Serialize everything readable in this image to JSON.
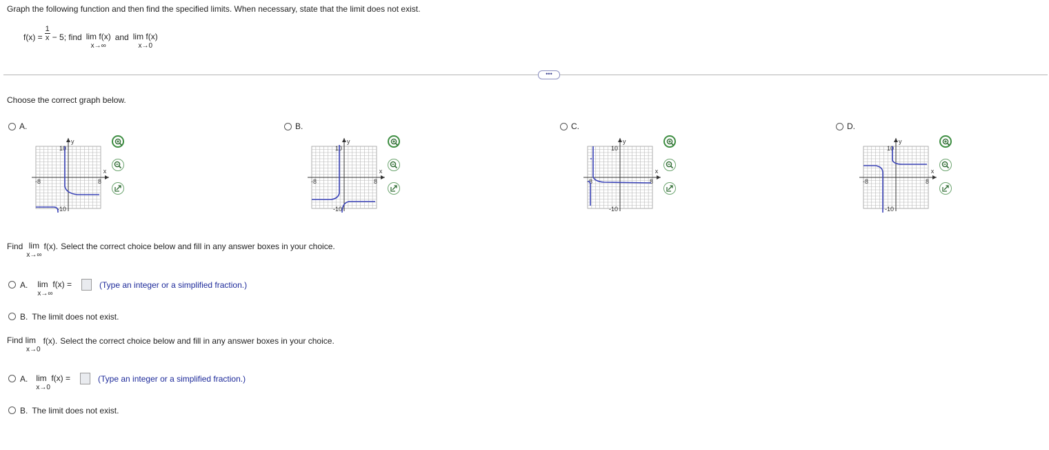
{
  "problem": {
    "instruction": "Graph the following function and then find the specified limits. When necessary, state that the limit does not exist.",
    "fx_prefix": "f(x) =",
    "frac_num": "1",
    "frac_den": "x",
    "fx_suffix": "− 5; find",
    "lim_word": "lim",
    "lim_expr": "f(x)",
    "and_word": "and",
    "sub_inf": "x→∞",
    "sub_zero": "x→0"
  },
  "divider": {
    "dots_label": "•••"
  },
  "graph_question": {
    "prompt": "Choose the correct graph below.",
    "options": [
      {
        "label": "A.",
        "ytick": "10",
        "ntick": "-10",
        "xneg": "-8",
        "xpos": "8",
        "xlab": "x",
        "ylab": "y"
      },
      {
        "label": "B.",
        "ytick": "10",
        "ntick": "-10",
        "xneg": "-8",
        "xpos": "8",
        "xlab": "x",
        "ylab": "y"
      },
      {
        "label": "C.",
        "ytick": "10",
        "ntick": "-10",
        "xneg": "-8",
        "xpos": "8",
        "xlab": "x",
        "ylab": "y"
      },
      {
        "label": "D.",
        "ytick": "10",
        "ntick": "-10",
        "xneg": "-8",
        "xpos": "8",
        "xlab": "x",
        "ylab": "y"
      }
    ],
    "icons": [
      "zoom-in-icon",
      "zoom-out-icon",
      "popout-icon"
    ]
  },
  "limit_inf": {
    "find": "Find",
    "lim": "lim",
    "fx": "f(x).",
    "sub": "x→∞",
    "rest": "Select the correct choice below and fill in any answer boxes in your choice.",
    "optA_label": "A.",
    "optA_lim": "lim",
    "optA_fx": "f(x) =",
    "optA_sub": "x→∞",
    "optA_value": "",
    "optA_hint": "(Type an integer or a simplified fraction.)",
    "optB_label": "B.",
    "optB_text": "The limit does not exist."
  },
  "limit_zero": {
    "find": "Find lim",
    "fx": "f(x).",
    "sub": "x→0",
    "rest": "Select the correct choice below and fill in any answer boxes in your choice.",
    "optA_label": "A.",
    "optA_lim": "lim",
    "optA_fx": "f(x) =",
    "optA_sub": "x→0",
    "optA_value": "",
    "optA_hint": "(Type an integer or a simplified fraction.)",
    "optB_label": "B.",
    "optB_text": "The limit does not exist."
  },
  "colors": {
    "curve": "#3a43b8",
    "accent_hint": "#1d2a9a",
    "zoom_green": "#3c8d40"
  }
}
